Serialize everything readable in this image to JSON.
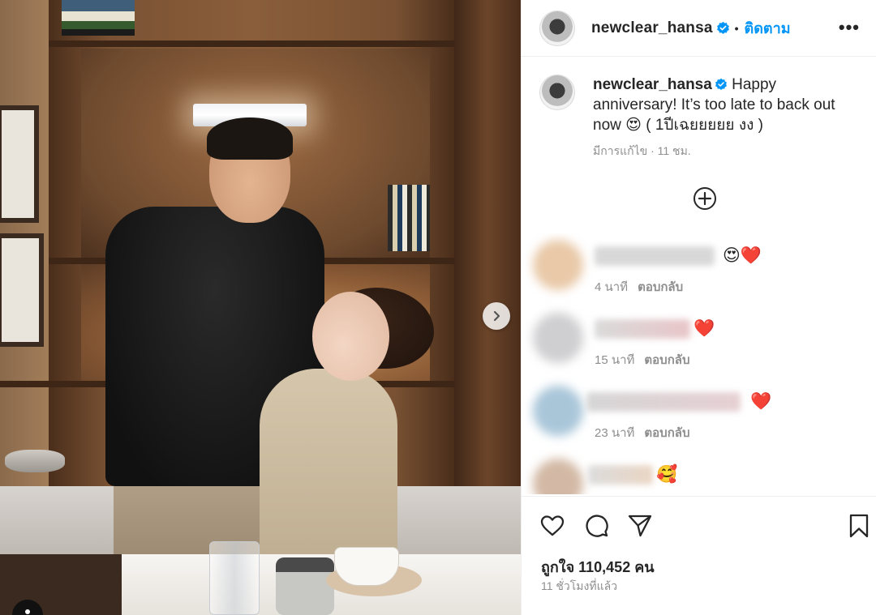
{
  "post": {
    "username": "newclear_hansa",
    "follow_label": "ติดตาม",
    "more_label": "•••",
    "caption_text": " Happy anniversary! It’s too late to back out now 😍 ( 1ปีเฉยยยยย งง )",
    "edited_time": "มีการแก้ไข · 11 ชม.",
    "likes": "ถูกใจ 110,452 คน",
    "time_ago": "11 ชั่วโมงที่แล้ว"
  },
  "comments": [
    {
      "emoji": "😍❤️",
      "time": "4 นาที",
      "reply": "ตอบกลับ"
    },
    {
      "emoji": "❤️",
      "time": "15 นาที",
      "reply": "ตอบกลับ"
    },
    {
      "emoji": "❤️",
      "time": "23 นาที",
      "reply": "ตอบกลับ"
    },
    {
      "emoji": "🥰",
      "time": "",
      "reply": ""
    }
  ],
  "icons": {
    "verified": "verified-badge-icon",
    "next": "chevron-right-icon",
    "add": "plus-circle-icon",
    "like": "heart-icon",
    "comment": "comment-icon",
    "share": "send-icon",
    "save": "bookmark-icon"
  },
  "colors": {
    "accent": "#0095f6",
    "text": "#262626",
    "muted": "#8e8e8e"
  }
}
